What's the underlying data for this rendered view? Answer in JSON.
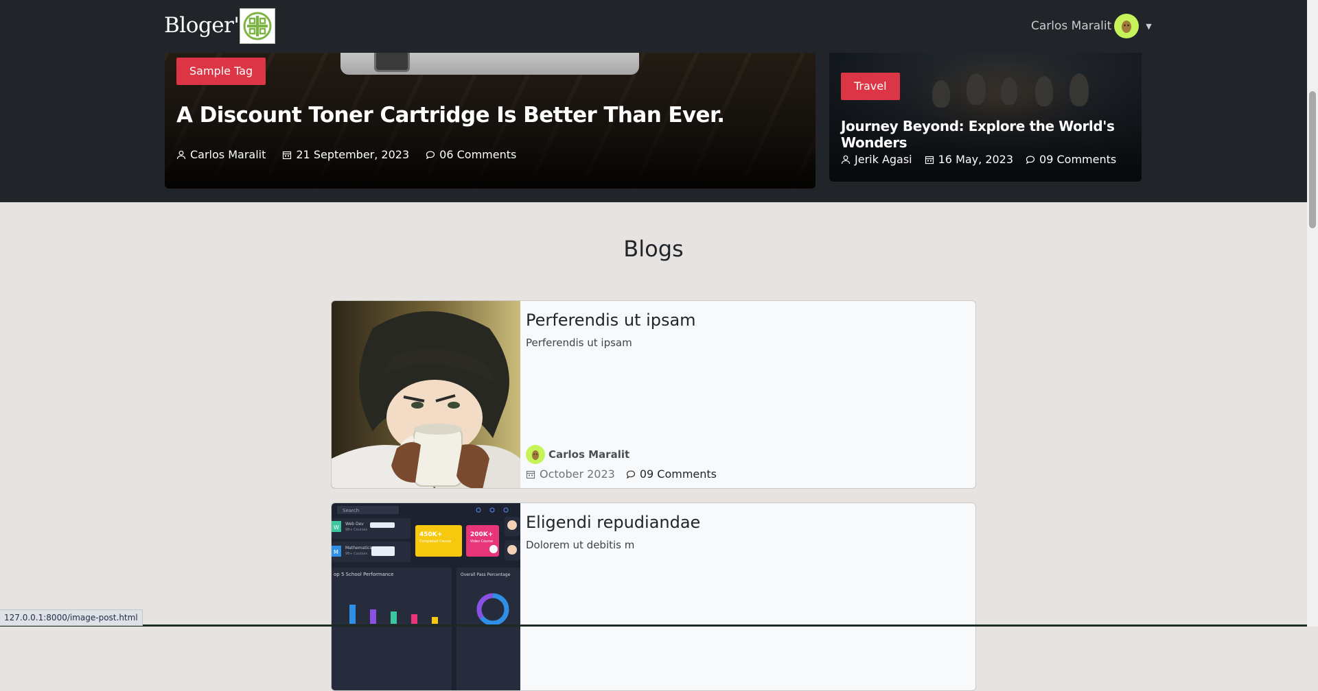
{
  "navbar": {
    "brand": "Bloger'z",
    "user_name": "Carlos Maralit"
  },
  "hero": {
    "main": {
      "tag": "Sample Tag",
      "title": "A Discount Toner Cartridge Is Better Than Ever.",
      "author": "Carlos Maralit",
      "date": "21 September, 2023",
      "comments": "06 Comments"
    },
    "side": {
      "tag": "Travel",
      "title": "Journey Beyond: Explore the World's Wonders",
      "author": "Jerik Agasi",
      "date": "16 May, 2023",
      "comments": "09 Comments"
    }
  },
  "blogs": {
    "section_title": "Blogs",
    "posts": [
      {
        "title": "Perferendis ut ipsam",
        "excerpt": "Perferendis ut ipsam",
        "author": "Carlos Maralit",
        "date": "October 2023",
        "comments": "09 Comments"
      },
      {
        "title": "Eligendi repudiandae",
        "excerpt": "Dolorem ut debitis m",
        "thumb": {
          "search": "Search",
          "row1_letter": "W",
          "row1_text": "Web Dev",
          "row1_sub": "98+ Courses",
          "row2_letter": "M",
          "row2_text": "Mathematics",
          "row2_sub": "98+ Courses",
          "stat1": "450K+",
          "stat1_sub": "Completed Course",
          "stat2": "200K+",
          "stat2_sub": "Video Course",
          "panel1": "op 5 School Performance",
          "panel2": "Overall Pass Percentage"
        }
      }
    ]
  },
  "statusbar": {
    "url": "127.0.0.1:8000/image-post.html"
  },
  "colors": {
    "navbar_bg": "#212529",
    "tag_red": "#dc3545",
    "page_bg": "#e7e3e1",
    "card_bg": "#f8f9fa",
    "avatar_green": "#c6f35a"
  }
}
